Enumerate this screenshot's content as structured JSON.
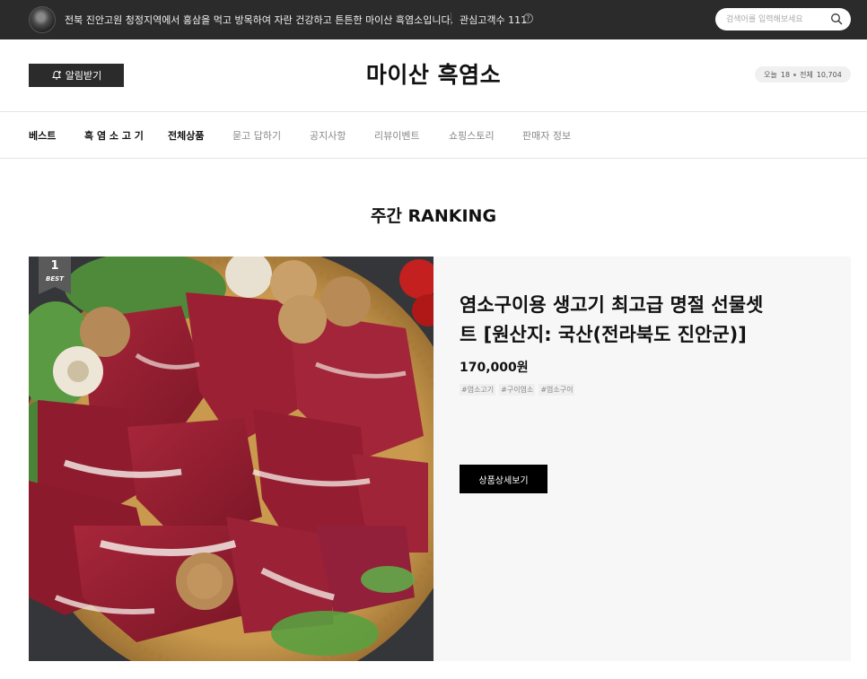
{
  "topbar": {
    "intro": "전북 진안고원 청정지역에서 홍삼을 먹고 방목하여 자란 건강하고 튼튼한 마이산 흑염소입니다.",
    "fav_label": "관심고객수",
    "fav_count": "111",
    "help_glyph": "?",
    "search_placeholder": "검색어를 입력해보세요"
  },
  "header": {
    "notify_label": "알림받기",
    "title": "마이산 흑염소",
    "today_label": "오늘",
    "today_count": "18",
    "total_label": "전체",
    "total_count": "10,704"
  },
  "nav": {
    "items": [
      {
        "label": "베스트"
      },
      {
        "label": "흑 염 소 고 기"
      },
      {
        "label": "전체상품"
      },
      {
        "label": "묻고 답하기"
      },
      {
        "label": "공지사항"
      },
      {
        "label": "리뷰이벤트"
      },
      {
        "label": "쇼핑스토리"
      },
      {
        "label": "판매자 정보"
      }
    ]
  },
  "ranking": {
    "title": "주간 RANKING",
    "item": {
      "rank": "1",
      "badge_text": "BEST",
      "name": "염소구이용 생고기 최고급 명절 선물셋트 [원산지: 국산(전라북도 진안군)]",
      "price": "170,000원",
      "tags": [
        "#염소고기",
        "#구이염소",
        "#염소구이"
      ],
      "detail_button": "상품상세보기"
    }
  },
  "colors": {
    "topbar_bg": "#2b2b2b",
    "button_dark": "#000000",
    "info_panel_bg": "#f7f7f8"
  },
  "icons": {
    "search": "search-icon",
    "notify": "bell-plus-icon",
    "help": "question-circle-icon"
  }
}
